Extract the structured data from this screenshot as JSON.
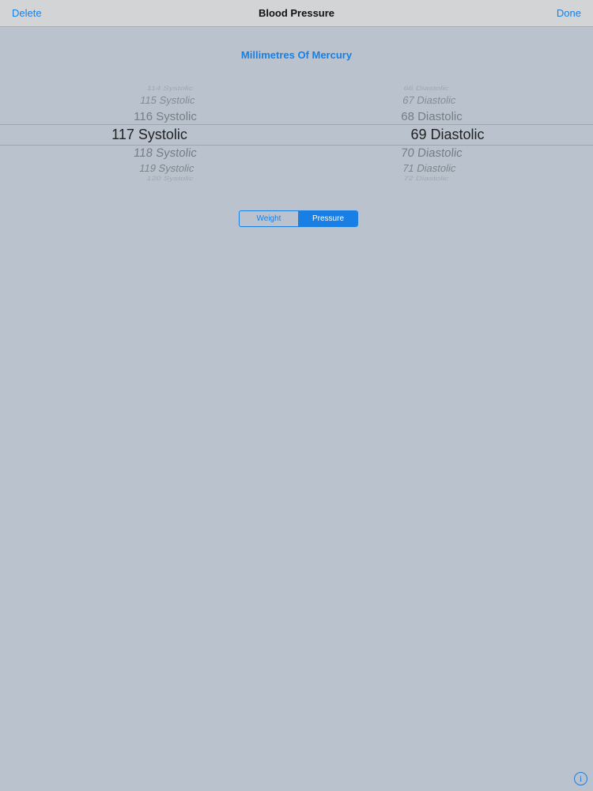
{
  "navbar": {
    "left_label": "Delete",
    "title": "Blood Pressure",
    "right_label": "Done"
  },
  "unit_label": "Millimetres Of Mercury",
  "picker": {
    "systolic": [
      {
        "label": "114 Systolic"
      },
      {
        "label": "115 Systolic"
      },
      {
        "label": "116 Systolic"
      },
      {
        "label": "117 Systolic",
        "selected": true
      },
      {
        "label": "118 Systolic"
      },
      {
        "label": "119 Systolic"
      },
      {
        "label": "120 Systolic"
      }
    ],
    "diastolic": [
      {
        "label": "66 Diastolic"
      },
      {
        "label": "67 Diastolic"
      },
      {
        "label": "68 Diastolic"
      },
      {
        "label": "69 Diastolic",
        "selected": true
      },
      {
        "label": "70 Diastolic"
      },
      {
        "label": "71 Diastolic"
      },
      {
        "label": "72 Diastolic"
      }
    ]
  },
  "segment": {
    "options": [
      "Weight",
      "Pressure"
    ],
    "selected": "Pressure"
  },
  "info": {
    "icon": "info-icon",
    "glyph": "i"
  },
  "colors": {
    "accent": "#1a7fe4",
    "background": "#bac3cd"
  }
}
